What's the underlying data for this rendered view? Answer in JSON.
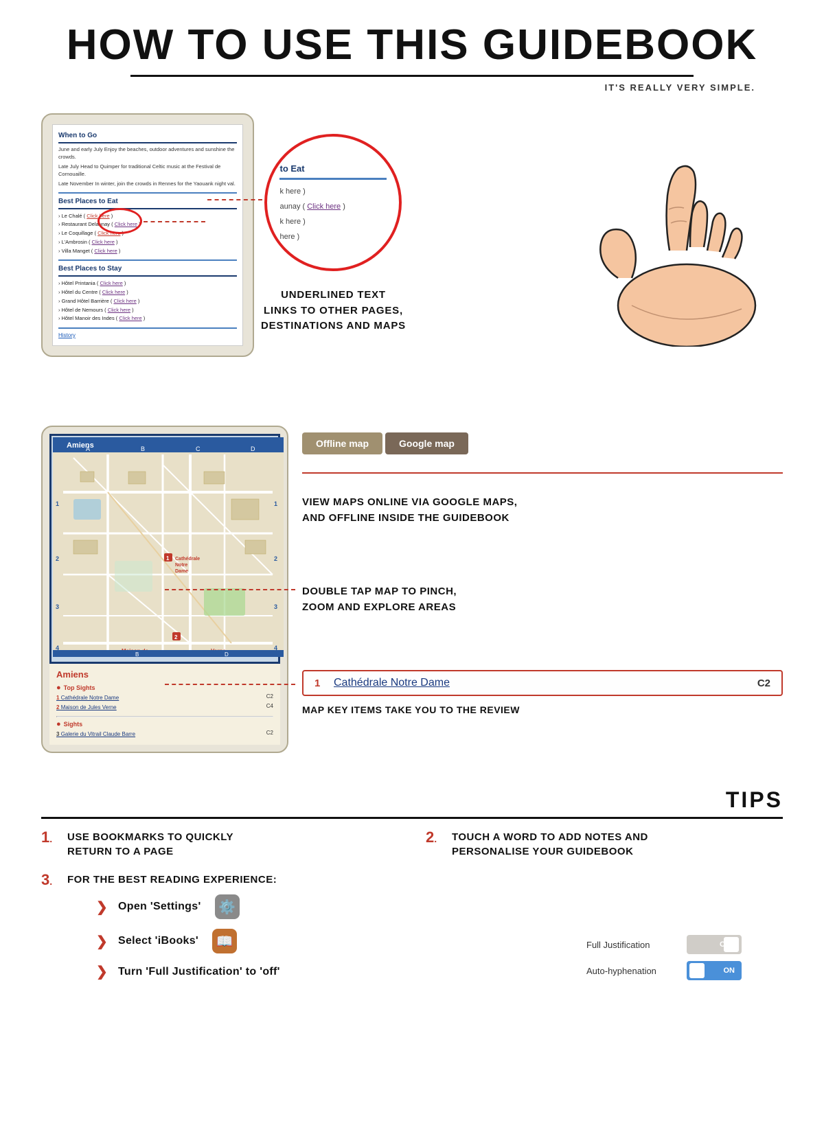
{
  "header": {
    "title": "HOW TO USE THIS GUIDEBOOK",
    "subtitle": "IT'S REALLY VERY SIMPLE."
  },
  "section1": {
    "phone": {
      "when_to_go": {
        "title": "When to Go",
        "text1": "June and early July Enjoy the beaches, outdoor adventures and sunshine the crowds.",
        "text2": "Late July Head to Quimper for traditional Celtic music at the Festival de Cornouaille.",
        "text3": "Late November In winter, join the crowds in Rennes for the Yaouank night val."
      },
      "best_places_to_eat": {
        "title": "Best Places to Eat",
        "items": [
          "› Le Chalé ( Click here )",
          "› Restaurant Delaunay ( Click here )",
          "› Le Coquillage ( Click here )",
          "› L'Ambrosin ( Click here )",
          "› Villa Manget ( Click here )"
        ]
      },
      "best_places_to_stay": {
        "title": "Best Places to Stay",
        "items": [
          "› Hôtel Printania ( Click here )",
          "› Hôtel du Centre ( Click here )",
          "› Grand Hôtel Barrière ( Click here )",
          "› Hôtel de Nemours ( Click here )",
          "› Hôtel Manoir des Indes ( Click here )"
        ]
      },
      "history_link": "History"
    },
    "zoom": {
      "title": "to Eat",
      "items": [
        "k here )",
        "aunay ( Click here )",
        "k here )",
        "here )"
      ]
    },
    "underlined_text": "UNDERLINED TEXT\nLINKS TO OTHER PAGES,\nDESTINATIONS AND MAPS"
  },
  "section2": {
    "map": {
      "city": "Amiens"
    },
    "legend": {
      "city": "Amiens",
      "top_sights_label": "Top Sights",
      "items": [
        {
          "num": "1",
          "name": "Cathédrale Notre Dame",
          "coord": "C2"
        },
        {
          "num": "2",
          "name": "Maison de Jules Verne",
          "coord": "C4"
        }
      ],
      "sights_label": "Sights",
      "sights_items": [
        {
          "num": "3",
          "name": "Galerie du Vitrail Claude Barre",
          "coord": "C2"
        }
      ]
    },
    "buttons": {
      "offline": "Offline map",
      "google": "Google map"
    },
    "desc1": "VIEW MAPS ONLINE VIA GOOGLE MAPS,\nAND OFFLINE INSIDE THE GUIDEBOOK",
    "desc2": "DOUBLE TAP MAP TO PINCH,\nZOOM AND EXPLORE AREAS",
    "key_box": {
      "num": "1",
      "name": "Cathédrale Notre Dame",
      "coord": "C2"
    },
    "key_desc": "MAP KEY ITEMS TAKE YOU TO THE REVIEW"
  },
  "tips": {
    "title": "TIPS",
    "items": [
      {
        "num": "1",
        "text": "USE BOOKMARKS TO QUICKLY\nRETURN TO A PAGE"
      },
      {
        "num": "2",
        "text": "TOUCH A WORD TO ADD NOTES AND\nPERSONALISE YOUR GUIDEBOOK"
      }
    ],
    "tip3": {
      "num": "3",
      "label": "FOR THE BEST READING EXPERIENCE:",
      "steps": [
        {
          "text": "Open 'Settings'",
          "icon": "⚙️"
        },
        {
          "text": "Select 'iBooks'",
          "icon": "📖"
        },
        {
          "text": "Turn 'Full Justification' to 'off'",
          "icon": null
        }
      ]
    },
    "toggles": [
      {
        "label": "Full Justification",
        "state": "OFF"
      },
      {
        "label": "Auto-hyphenation",
        "state": "ON"
      }
    ]
  }
}
